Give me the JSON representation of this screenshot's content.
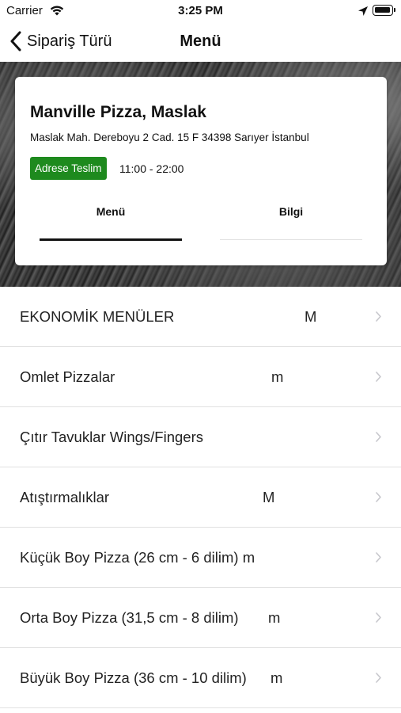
{
  "status_bar": {
    "carrier": "Carrier",
    "time": "3:25 PM"
  },
  "nav": {
    "back_label": "Sipariş Türü",
    "title": "Menü"
  },
  "restaurant": {
    "name": "Manville Pizza, Maslak",
    "address": "Maslak Mah. Dereboyu 2 Cad. 15 F 34398 Sarıyer İstanbul",
    "delivery_badge": "Adrese Teslim",
    "hours": "11:00 - 22:00",
    "badge_color": "#1e8a1e"
  },
  "tabs": [
    {
      "label": "Menü",
      "active": true
    },
    {
      "label": "Bilgi",
      "active": false
    }
  ],
  "menu_items": [
    {
      "label": "EKONOMİK MENÜLER",
      "mark": "M"
    },
    {
      "label": "Omlet Pizzalar",
      "mark": "m"
    },
    {
      "label": "Çıtır Tavuklar Wings/Fingers",
      "mark": ""
    },
    {
      "label": "Atıştırmalıklar",
      "mark": "M"
    },
    {
      "label": "Küçük Boy Pizza (26 cm - 6 dilim) m",
      "mark": ""
    },
    {
      "label": "Orta Boy Pizza (31,5 cm - 8 dilim)",
      "mark": "m"
    },
    {
      "label": "Büyük Boy Pizza (36 cm - 10 dilim)",
      "mark": "m"
    }
  ],
  "icons": {
    "back": "chevron-left-icon",
    "row": "chevron-right-icon"
  }
}
